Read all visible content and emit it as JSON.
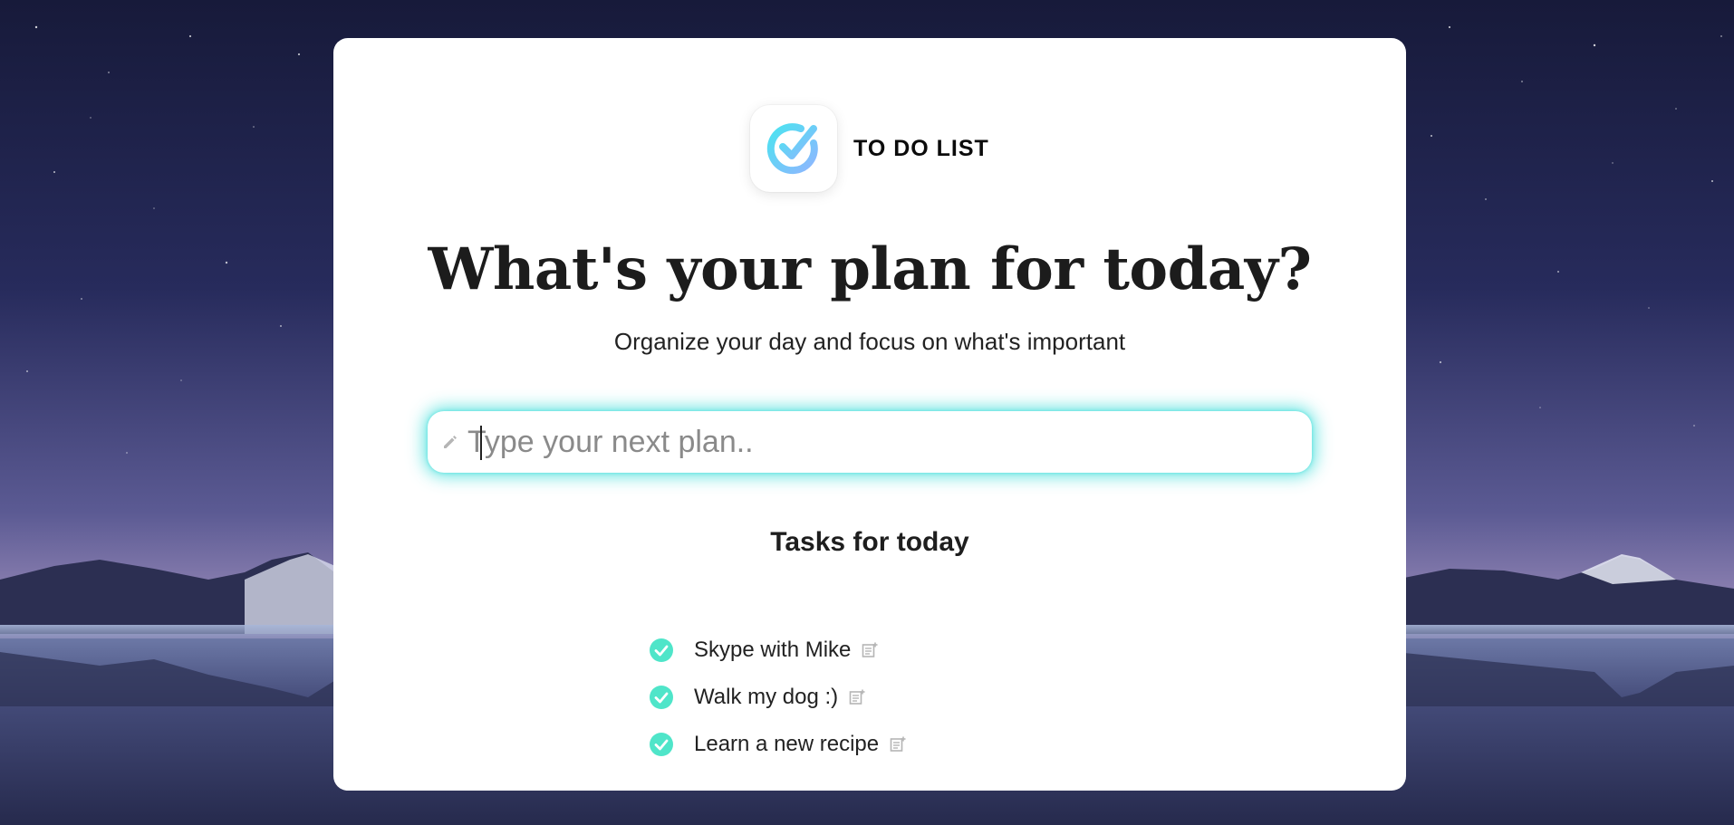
{
  "brand": {
    "name": "TO DO LIST",
    "logo_icon": "check-circle-icon"
  },
  "main": {
    "headline": "What's your plan for today?",
    "subtitle": "Organize your day and focus on what's important"
  },
  "input": {
    "placeholder": "Type your next plan..",
    "value": "",
    "icon": "pencil-icon"
  },
  "tasks": {
    "title": "Tasks for today",
    "items": [
      {
        "text": "Skype with Mike",
        "done": true
      },
      {
        "text": "Walk my dog :)",
        "done": true
      },
      {
        "text": "Learn a new recipe",
        "done": true
      }
    ]
  },
  "colors": {
    "accent": "#4fe5c9",
    "input_glow": "#4fe1dd",
    "logo_gradient_start": "#4be3f0",
    "logo_gradient_end": "#8fb6ff",
    "card_background": "#ffffff",
    "text_dark": "#1c1c1c",
    "icon_gray": "#b5b5b5"
  }
}
